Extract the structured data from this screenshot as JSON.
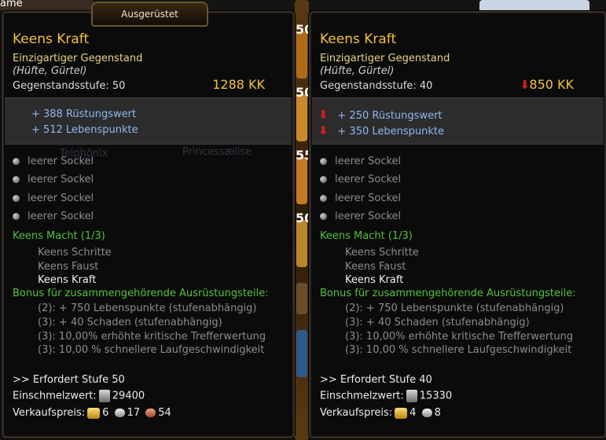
{
  "background": {
    "corner_text": "ame",
    "ghost_names": [
      "Telphönix",
      "Princessælise"
    ],
    "slot_numbers": [
      "50",
      "50",
      "55",
      "50"
    ]
  },
  "left": {
    "tab_label": "Ausgerüstet",
    "name": "Keens  Kraft",
    "rarity": "Einzigartiger  Gegenstand",
    "slots": "(Hüfte, Gürtel)",
    "item_level": "Gegenstandsstufe:  50",
    "kk": "1288  KK",
    "stats": [
      "+  388  Rüstungswert",
      "+  512  Lebenspunkte"
    ],
    "sockets": [
      "leerer  Sockel",
      "leerer  Sockel",
      "leerer  Sockel",
      "leerer  Sockel"
    ],
    "set_title": "Keens  Macht  (1/3)",
    "set_items": [
      "Keens  Schritte",
      "Keens  Faust",
      "Keens  Kraft"
    ],
    "bonus_title": "Bonus für  zusammengehörende  Ausrüstungsteile:",
    "bonuses": [
      "(2):  +  750  Lebenspunkte  (stufenabhängig)",
      "(3):  +  40  Schaden  (stufenabhängig)",
      "(3):  10,00%  erhöhte  kritische  Trefferwertung",
      "(3):  10,00  %  schnellere  Laufgeschwindigkeit"
    ],
    "requirement": ">>  Erfordert  Stufe  50",
    "melt_label": "Einschmelzwert:",
    "melt_value": "29400",
    "sell_label": "Verkaufspreis:",
    "sell_gold": "6",
    "sell_silver": "17",
    "sell_copper": "54"
  },
  "right": {
    "name": "Keens  Kraft",
    "rarity": "Einzigartiger  Gegenstand",
    "slots": "(Hüfte, Gürtel)",
    "item_level": "Gegenstandsstufe:  40",
    "kk": "850  KK",
    "stats": [
      "+  250  Rüstungswert",
      "+  350  Lebenspunkte"
    ],
    "sockets": [
      "leerer  Sockel",
      "leerer  Sockel",
      "leerer  Sockel",
      "leerer  Sockel"
    ],
    "set_title": "Keens  Macht  (1/3)",
    "set_items": [
      "Keens  Schritte",
      "Keens  Faust",
      "Keens  Kraft"
    ],
    "bonus_title": "Bonus für  zusammengehörende  Ausrüstungsteile:",
    "bonuses": [
      "(2):  +  750  Lebenspunkte  (stufenabhängig)",
      "(3):  +  40  Schaden  (stufenabhängig)",
      "(3):  10,00%  erhöhte  kritische  Trefferwertung",
      "(3):  10,00  %  schnellere  Laufgeschwindigkeit"
    ],
    "requirement": ">>  Erfordert  Stufe  40",
    "melt_label": "Einschmelzwert:",
    "melt_value": "15330",
    "sell_label": "Verkaufspreis:",
    "sell_gold": "4",
    "sell_silver": "8"
  },
  "icons": {
    "downgrade": "red-down-arrow-icon",
    "socket": "empty-socket-icon",
    "gold": "gold-coin-icon",
    "silver": "silver-coin-icon",
    "copper": "copper-coin-icon",
    "melt": "crystal-dust-icon"
  },
  "colors": {
    "item_name": "#f4c23b",
    "stat": "#8fb8ee",
    "set_green": "#52c23b",
    "downgrade_red": "#d71c1c",
    "panel_bg": "#0b0b0b"
  }
}
